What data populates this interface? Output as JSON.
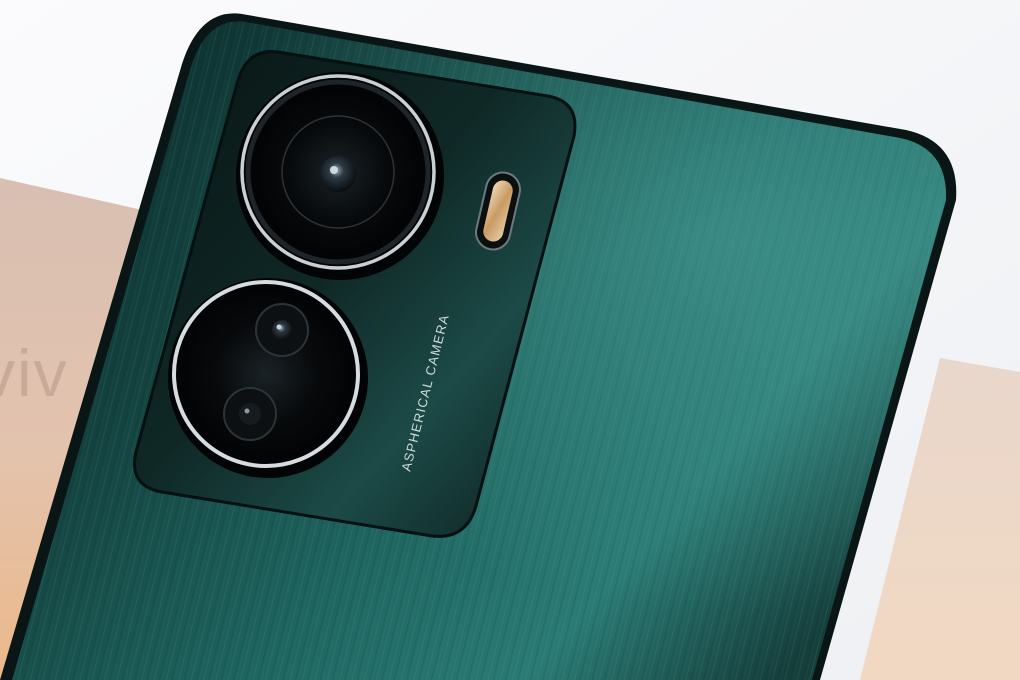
{
  "scene": {
    "subject": "smartphone-rear-camera-module",
    "camera_label": "ASPHERICAL CAMERA",
    "box_logo_fragment": "viv",
    "colors": {
      "backdrop_white": "#f4f5f7",
      "box_pink": "#dcc1b2",
      "box_peach": "#e9b98f",
      "phone_teal_dark": "#0e2f2e",
      "phone_teal_mid": "#1b5a57",
      "phone_teal_light": "#3a8a84",
      "camera_island": "#0a1716",
      "lens_black": "#050708",
      "lens_ring": "#d8dde0",
      "flash_amber": "#d7b07a"
    },
    "icons": [
      "main-camera-lens-icon",
      "secondary-camera-lens-icon",
      "depth-sensor-icon",
      "flash-led-icon"
    ]
  }
}
